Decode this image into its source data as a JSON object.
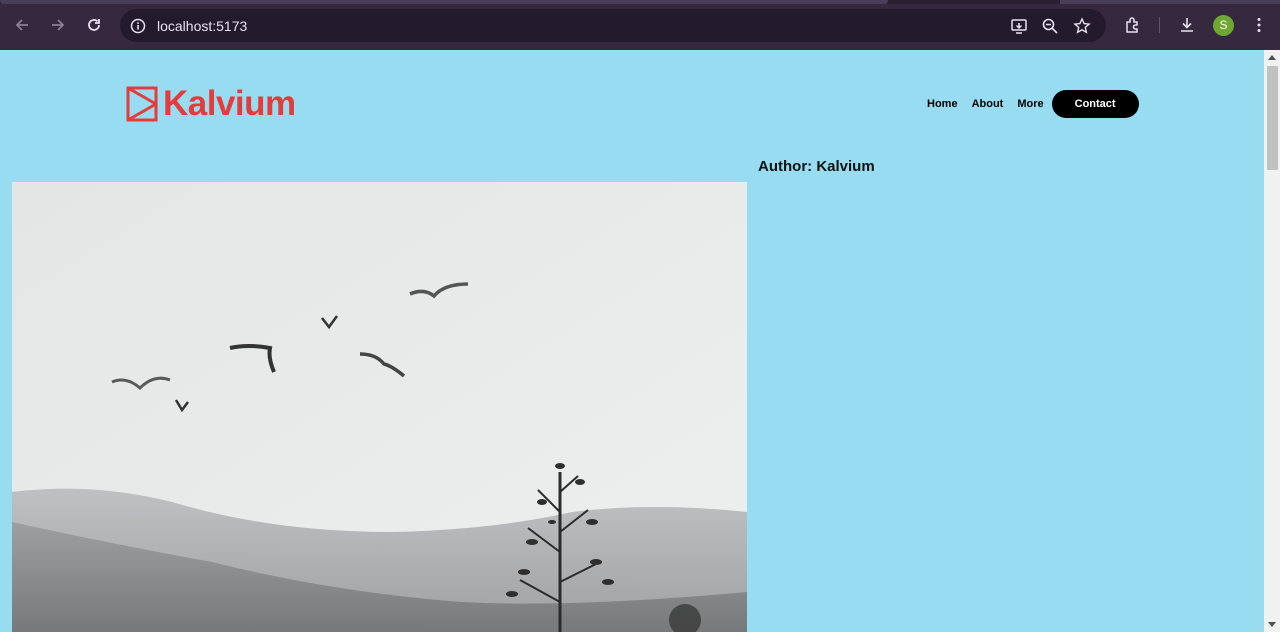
{
  "browser": {
    "url": "localhost:5173",
    "profile_initial": "S",
    "icons": [
      "back-icon",
      "forward-icon",
      "reload-icon",
      "site-info-icon",
      "install-app-icon",
      "zoom-icon",
      "bookmark-star-icon",
      "extensions-icon",
      "downloads-icon",
      "menu-icon"
    ]
  },
  "site": {
    "logo_text": "Kalvium",
    "brand_color": "#e53b3b",
    "nav": {
      "home": "Home",
      "about": "About",
      "more": "More",
      "contact": "Contact"
    },
    "author_line": "Author: Kalvium",
    "background_color": "#97dcf1"
  }
}
